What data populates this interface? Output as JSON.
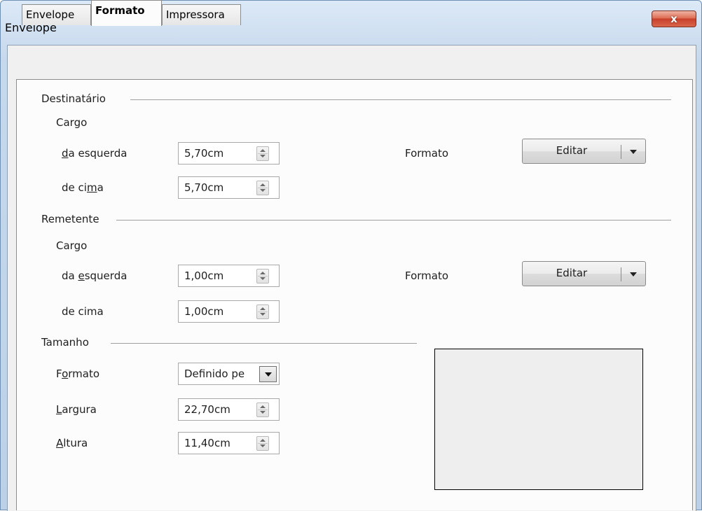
{
  "window": {
    "title": "Envelope",
    "close_label": "x"
  },
  "tabs": [
    {
      "label": "Envelope"
    },
    {
      "label": "Formato"
    },
    {
      "label": "Impressora"
    }
  ],
  "destinatario": {
    "heading": "Destinatário",
    "cargo": "Cargo",
    "left_label_pre": "",
    "left_label_ul": "d",
    "left_label_post": "a esquerda",
    "left_value": "5,70cm",
    "top_label_pre": "de ci",
    "top_label_ul": "m",
    "top_label_post": "a",
    "top_value": "5,70cm",
    "format_label": "Formato",
    "edit_label": "Editar"
  },
  "remetente": {
    "heading": "Remetente",
    "cargo": "Cargo",
    "left_label_pre": "da ",
    "left_label_ul": "e",
    "left_label_post": "squerda",
    "left_value": "1,00cm",
    "top_label": "de cima",
    "top_value": "1,00cm",
    "format_label": "Formato",
    "edit_label": "Editar"
  },
  "tamanho": {
    "heading": "Tamanho",
    "format_pre": "F",
    "format_ul": "o",
    "format_post": "rmato",
    "format_value": "Definido pe",
    "width_ul": "L",
    "width_post": "argura",
    "width_value": "22,70cm",
    "height_ul": "A",
    "height_post": "ltura",
    "height_value": "11,40cm"
  }
}
